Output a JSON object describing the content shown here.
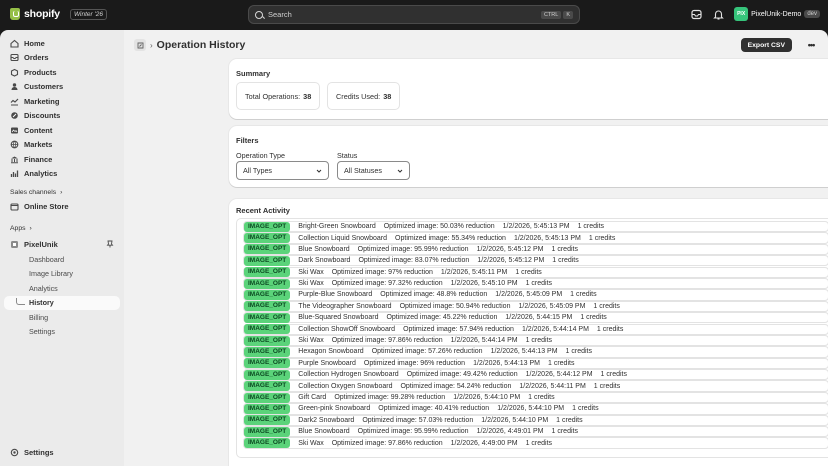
{
  "topbar": {
    "brand": "shopify",
    "edition": "Winter '26",
    "search_placeholder": "Search",
    "shortcut_ctrl": "CTRL",
    "shortcut_k": "K",
    "store_initials": "PIX",
    "store_name": "PixelUnik-Demo",
    "store_badge": "dev"
  },
  "sidebar": {
    "items": [
      {
        "label": "Home",
        "icon": "home-icon"
      },
      {
        "label": "Orders",
        "icon": "orders-icon"
      },
      {
        "label": "Products",
        "icon": "products-icon"
      },
      {
        "label": "Customers",
        "icon": "customers-icon"
      },
      {
        "label": "Marketing",
        "icon": "marketing-icon"
      },
      {
        "label": "Discounts",
        "icon": "discounts-icon"
      },
      {
        "label": "Content",
        "icon": "content-icon"
      },
      {
        "label": "Markets",
        "icon": "markets-icon"
      },
      {
        "label": "Finance",
        "icon": "finance-icon"
      },
      {
        "label": "Analytics",
        "icon": "analytics-icon"
      }
    ],
    "sales_channels_label": "Sales channels",
    "online_store_label": "Online Store",
    "apps_label": "Apps",
    "app_name": "PixelUnik",
    "app_subitems": [
      "Dashboard",
      "Image Library",
      "Analytics",
      "History",
      "Billing",
      "Settings"
    ],
    "active_subitem": "History",
    "settings_label": "Settings"
  },
  "header": {
    "title": "Operation History",
    "export_label": "Export CSV",
    "more_label": "•••"
  },
  "summary": {
    "title": "Summary",
    "total_label": "Total Operations:",
    "total_value": "38",
    "credits_label": "Credits Used:",
    "credits_value": "38"
  },
  "filters": {
    "title": "Filters",
    "type_label": "Operation Type",
    "type_value": "All Types",
    "status_label": "Status",
    "status_value": "All Statuses"
  },
  "activity": {
    "title": "Recent Activity",
    "rows": [
      {
        "type": "IMAGE_OPT",
        "name": "Bright-Green Snowboard",
        "detail": "Optimized image: 50.03% reduction",
        "time": "1/2/2026, 5:45:13 PM",
        "credits": "1 credits"
      },
      {
        "type": "IMAGE_OPT",
        "name": "Collection Liquid Snowboard",
        "detail": "Optimized image: 55.34% reduction",
        "time": "1/2/2026, 5:45:13 PM",
        "credits": "1 credits"
      },
      {
        "type": "IMAGE_OPT",
        "name": "Blue Snowboard",
        "detail": "Optimized image: 95.99% reduction",
        "time": "1/2/2026, 5:45:12 PM",
        "credits": "1 credits"
      },
      {
        "type": "IMAGE_OPT",
        "name": "Dark Snowboard",
        "detail": "Optimized image: 83.07% reduction",
        "time": "1/2/2026, 5:45:12 PM",
        "credits": "1 credits"
      },
      {
        "type": "IMAGE_OPT",
        "name": "Ski Wax",
        "detail": "Optimized image: 97% reduction",
        "time": "1/2/2026, 5:45:11 PM",
        "credits": "1 credits"
      },
      {
        "type": "IMAGE_OPT",
        "name": "Ski Wax",
        "detail": "Optimized image: 97.32% reduction",
        "time": "1/2/2026, 5:45:10 PM",
        "credits": "1 credits"
      },
      {
        "type": "IMAGE_OPT",
        "name": "Purple-Blue Snowboard",
        "detail": "Optimized image: 48.8% reduction",
        "time": "1/2/2026, 5:45:09 PM",
        "credits": "1 credits"
      },
      {
        "type": "IMAGE_OPT",
        "name": "The Videographer Snowboard",
        "detail": "Optimized image: 50.94% reduction",
        "time": "1/2/2026, 5:45:09 PM",
        "credits": "1 credits"
      },
      {
        "type": "IMAGE_OPT",
        "name": "Blue-Squared Snowboard",
        "detail": "Optimized image: 45.22% reduction",
        "time": "1/2/2026, 5:44:15 PM",
        "credits": "1 credits"
      },
      {
        "type": "IMAGE_OPT",
        "name": "Collection ShowOff Snowboard",
        "detail": "Optimized image: 57.94% reduction",
        "time": "1/2/2026, 5:44:14 PM",
        "credits": "1 credits"
      },
      {
        "type": "IMAGE_OPT",
        "name": "Ski Wax",
        "detail": "Optimized image: 97.86% reduction",
        "time": "1/2/2026, 5:44:14 PM",
        "credits": "1 credits"
      },
      {
        "type": "IMAGE_OPT",
        "name": "Hexagon Snowboard",
        "detail": "Optimized image: 57.26% reduction",
        "time": "1/2/2026, 5:44:13 PM",
        "credits": "1 credits"
      },
      {
        "type": "IMAGE_OPT",
        "name": "Purple Snowboard",
        "detail": "Optimized image: 96% reduction",
        "time": "1/2/2026, 5:44:13 PM",
        "credits": "1 credits"
      },
      {
        "type": "IMAGE_OPT",
        "name": "Collection Hydrogen Snowboard",
        "detail": "Optimized image: 49.42% reduction",
        "time": "1/2/2026, 5:44:12 PM",
        "credits": "1 credits"
      },
      {
        "type": "IMAGE_OPT",
        "name": "Collection Oxygen Snowboard",
        "detail": "Optimized image: 54.24% reduction",
        "time": "1/2/2026, 5:44:11 PM",
        "credits": "1 credits"
      },
      {
        "type": "IMAGE_OPT",
        "name": "Gift Card",
        "detail": "Optimized image: 99.28% reduction",
        "time": "1/2/2026, 5:44:10 PM",
        "credits": "1 credits"
      },
      {
        "type": "IMAGE_OPT",
        "name": "Green-pink Snowboard",
        "detail": "Optimized image: 40.41% reduction",
        "time": "1/2/2026, 5:44:10 PM",
        "credits": "1 credits"
      },
      {
        "type": "IMAGE_OPT",
        "name": "Dark2 Snowboard",
        "detail": "Optimized image: 57.03% reduction",
        "time": "1/2/2026, 5:44:10 PM",
        "credits": "1 credits"
      },
      {
        "type": "IMAGE_OPT",
        "name": "Blue Snowboard",
        "detail": "Optimized image: 95.99% reduction",
        "time": "1/2/2026, 4:49:01 PM",
        "credits": "1 credits"
      },
      {
        "type": "IMAGE_OPT",
        "name": "Ski Wax",
        "detail": "Optimized image: 97.86% reduction",
        "time": "1/2/2026, 4:49:00 PM",
        "credits": "1 credits"
      }
    ]
  },
  "colors": {
    "topbar_bg": "#1a1a1a",
    "badge_green": "#5bd37a",
    "primary_button": "#303030"
  }
}
